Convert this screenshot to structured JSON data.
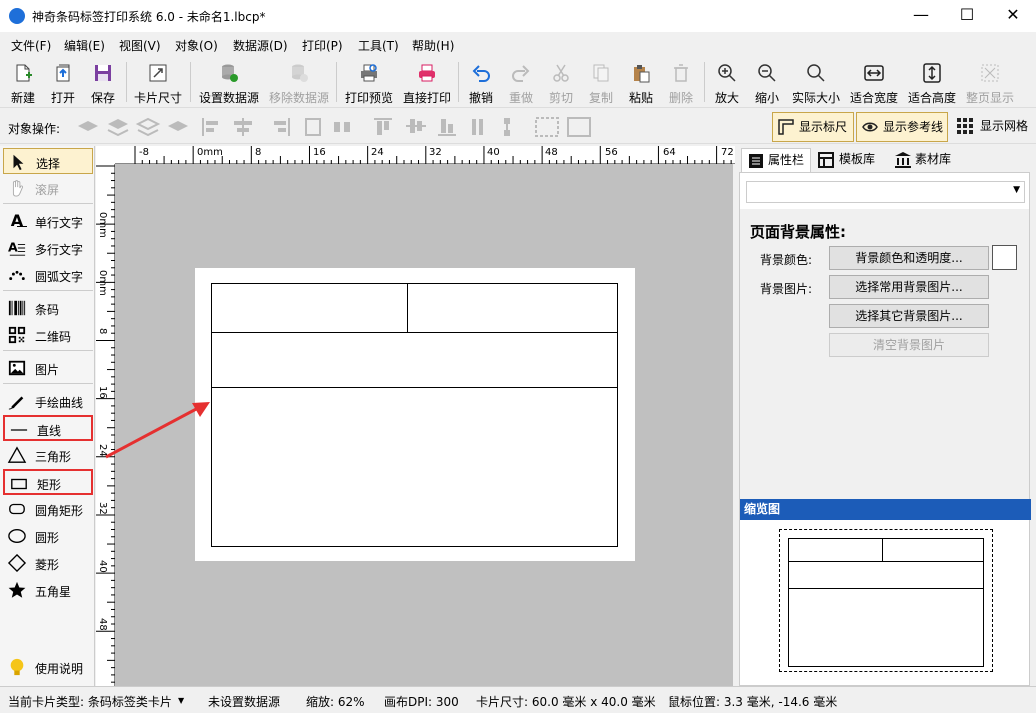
{
  "window": {
    "title": "神奇条码标签打印系统 6.0 - 未命名1.lbcp*",
    "minimize": "—",
    "maximize": "☐",
    "close": "✕"
  },
  "menu": [
    "文件(F)",
    "编辑(E)",
    "视图(V)",
    "对象(O)",
    "数据源(D)",
    "打印(P)",
    "工具(T)",
    "帮助(H)"
  ],
  "toolbar": [
    {
      "label": "新建",
      "icon": "new-file-icon"
    },
    {
      "label": "打开",
      "icon": "open-icon"
    },
    {
      "label": "保存",
      "icon": "save-icon"
    },
    {
      "label": "卡片尺寸",
      "icon": "card-size-icon"
    },
    {
      "label": "设置数据源",
      "icon": "database-icon"
    },
    {
      "label": "移除数据源",
      "icon": "remove-database-icon"
    },
    {
      "label": "打印预览",
      "icon": "print-preview-icon"
    },
    {
      "label": "直接打印",
      "icon": "printer-icon"
    },
    {
      "label": "撤销",
      "icon": "undo-icon"
    },
    {
      "label": "重做",
      "icon": "redo-icon"
    },
    {
      "label": "剪切",
      "icon": "cut-icon"
    },
    {
      "label": "复制",
      "icon": "copy-icon"
    },
    {
      "label": "粘贴",
      "icon": "paste-icon"
    },
    {
      "label": "删除",
      "icon": "delete-icon"
    },
    {
      "label": "放大",
      "icon": "zoom-in-icon"
    },
    {
      "label": "缩小",
      "icon": "zoom-out-icon"
    },
    {
      "label": "实际大小",
      "icon": "actual-size-icon"
    },
    {
      "label": "适合宽度",
      "icon": "fit-width-icon"
    },
    {
      "label": "适合高度",
      "icon": "fit-height-icon"
    },
    {
      "label": "整页显示",
      "icon": "fit-page-icon"
    }
  ],
  "objbar": {
    "label": "对象操作:",
    "show_ruler": "显示标尺",
    "show_guides": "显示参考线",
    "show_grid": "显示网格"
  },
  "tools": [
    {
      "label": "选择",
      "icon": "pointer-icon"
    },
    {
      "label": "滚屏",
      "icon": "hand-icon"
    },
    {
      "label": "单行文字",
      "icon": "single-text-icon"
    },
    {
      "label": "多行文字",
      "icon": "multi-text-icon"
    },
    {
      "label": "圆弧文字",
      "icon": "arc-text-icon"
    },
    {
      "label": "条码",
      "icon": "barcode-icon"
    },
    {
      "label": "二维码",
      "icon": "qrcode-icon"
    },
    {
      "label": "图片",
      "icon": "image-icon"
    },
    {
      "label": "手绘曲线",
      "icon": "pen-icon"
    },
    {
      "label": "直线",
      "icon": "line-icon"
    },
    {
      "label": "三角形",
      "icon": "triangle-icon"
    },
    {
      "label": "矩形",
      "icon": "rectangle-icon"
    },
    {
      "label": "圆角矩形",
      "icon": "rounded-rect-icon"
    },
    {
      "label": "圆形",
      "icon": "circle-icon"
    },
    {
      "label": "菱形",
      "icon": "diamond-icon"
    },
    {
      "label": "五角星",
      "icon": "star-icon"
    },
    {
      "label": "使用说明",
      "icon": "bulb-icon"
    }
  ],
  "hruler": [
    "-8",
    "0mm",
    "8",
    "16",
    "24",
    "32",
    "40",
    "48",
    "56",
    "64",
    "72"
  ],
  "vruler": [
    "-8",
    "0mm",
    "8",
    "16",
    "24",
    "32",
    "40",
    "48"
  ],
  "tabs": [
    "属性栏",
    "模板库",
    "素材库"
  ],
  "props": {
    "section_title": "页面背景属性:",
    "bg_color_label": "背景颜色:",
    "bg_color_button": "背景颜色和透明度...",
    "bg_image_label": "背景图片:",
    "common_bg_button": "选择常用背景图片...",
    "other_bg_button": "选择其它背景图片...",
    "clear_bg_button": "清空背景图片"
  },
  "preview_title": "缩览图",
  "status": {
    "card_type": "当前卡片类型: 条码标签类卡片",
    "datasource": "未设置数据源",
    "zoom": "缩放: 62%",
    "dpi": "画布DPI: 300",
    "card_size": "卡片尺寸: 60.0 毫米 x 40.0 毫米",
    "mouse": "鼠标位置: 3.3 毫米, -14.6 毫米"
  }
}
